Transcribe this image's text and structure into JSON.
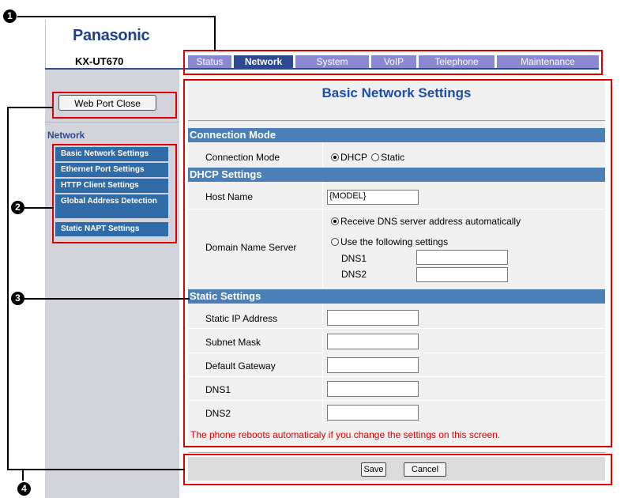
{
  "brand": {
    "logo": "Panasonic",
    "model": "KX-UT670"
  },
  "tabs": [
    {
      "label": "Status",
      "active": false
    },
    {
      "label": "Network",
      "active": true
    },
    {
      "label": "System",
      "active": false
    },
    {
      "label": "VoIP",
      "active": false
    },
    {
      "label": "Telephone",
      "active": false
    },
    {
      "label": "Maintenance",
      "active": false
    }
  ],
  "sidebar": {
    "web_port_button": "Web Port Close",
    "section_title": "Network",
    "items": [
      {
        "label": "Basic Network Settings"
      },
      {
        "label": "Ethernet Port Settings"
      },
      {
        "label": "HTTP Client Settings"
      },
      {
        "label": "Global Address Detection"
      },
      {
        "label": "Static NAPT Settings"
      }
    ]
  },
  "main": {
    "title": "Basic Network Settings",
    "connection_mode": {
      "header": "Connection Mode",
      "label": "Connection Mode",
      "options": [
        "DHCP",
        "Static"
      ],
      "selected": "DHCP"
    },
    "dhcp": {
      "header": "DHCP Settings",
      "host_name_label": "Host Name",
      "host_name_value": "{MODEL}",
      "dns_label": "Domain Name Server",
      "dns_auto_label": "Receive DNS server address automatically",
      "dns_manual_label": "Use the following settings",
      "dns1_label": "DNS1",
      "dns2_label": "DNS2",
      "dns1_value": "",
      "dns2_value": ""
    },
    "static": {
      "header": "Static Settings",
      "fields": [
        {
          "label": "Static IP Address",
          "value": ""
        },
        {
          "label": "Subnet Mask",
          "value": ""
        },
        {
          "label": "Default Gateway",
          "value": ""
        },
        {
          "label": "DNS1",
          "value": ""
        },
        {
          "label": "DNS2",
          "value": ""
        }
      ]
    },
    "note": "The phone reboots automaticaly if you change the settings on this screen."
  },
  "actions": {
    "save": "Save",
    "cancel": "Cancel"
  },
  "callouts": [
    "1",
    "2",
    "3",
    "4"
  ]
}
